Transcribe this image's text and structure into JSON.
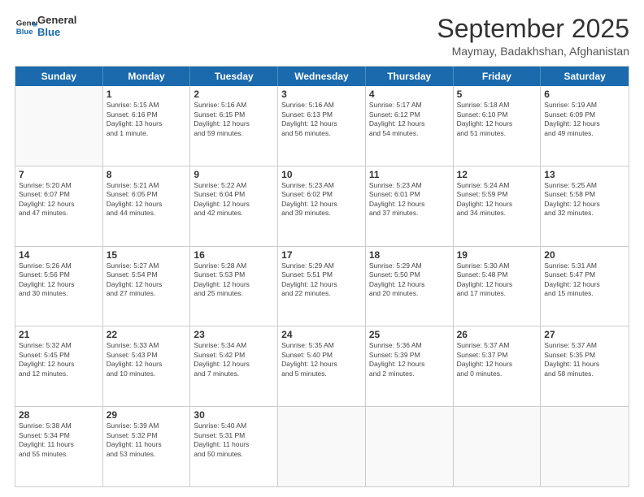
{
  "logo": {
    "line1": "General",
    "line2": "Blue"
  },
  "title": "September 2025",
  "location": "Maymay, Badakhshan, Afghanistan",
  "header_days": [
    "Sunday",
    "Monday",
    "Tuesday",
    "Wednesday",
    "Thursday",
    "Friday",
    "Saturday"
  ],
  "weeks": [
    [
      {
        "day": "",
        "lines": []
      },
      {
        "day": "1",
        "lines": [
          "Sunrise: 5:15 AM",
          "Sunset: 6:16 PM",
          "Daylight: 13 hours",
          "and 1 minute."
        ]
      },
      {
        "day": "2",
        "lines": [
          "Sunrise: 5:16 AM",
          "Sunset: 6:15 PM",
          "Daylight: 12 hours",
          "and 59 minutes."
        ]
      },
      {
        "day": "3",
        "lines": [
          "Sunrise: 5:16 AM",
          "Sunset: 6:13 PM",
          "Daylight: 12 hours",
          "and 56 minutes."
        ]
      },
      {
        "day": "4",
        "lines": [
          "Sunrise: 5:17 AM",
          "Sunset: 6:12 PM",
          "Daylight: 12 hours",
          "and 54 minutes."
        ]
      },
      {
        "day": "5",
        "lines": [
          "Sunrise: 5:18 AM",
          "Sunset: 6:10 PM",
          "Daylight: 12 hours",
          "and 51 minutes."
        ]
      },
      {
        "day": "6",
        "lines": [
          "Sunrise: 5:19 AM",
          "Sunset: 6:09 PM",
          "Daylight: 12 hours",
          "and 49 minutes."
        ]
      }
    ],
    [
      {
        "day": "7",
        "lines": [
          "Sunrise: 5:20 AM",
          "Sunset: 6:07 PM",
          "Daylight: 12 hours",
          "and 47 minutes."
        ]
      },
      {
        "day": "8",
        "lines": [
          "Sunrise: 5:21 AM",
          "Sunset: 6:05 PM",
          "Daylight: 12 hours",
          "and 44 minutes."
        ]
      },
      {
        "day": "9",
        "lines": [
          "Sunrise: 5:22 AM",
          "Sunset: 6:04 PM",
          "Daylight: 12 hours",
          "and 42 minutes."
        ]
      },
      {
        "day": "10",
        "lines": [
          "Sunrise: 5:23 AM",
          "Sunset: 6:02 PM",
          "Daylight: 12 hours",
          "and 39 minutes."
        ]
      },
      {
        "day": "11",
        "lines": [
          "Sunrise: 5:23 AM",
          "Sunset: 6:01 PM",
          "Daylight: 12 hours",
          "and 37 minutes."
        ]
      },
      {
        "day": "12",
        "lines": [
          "Sunrise: 5:24 AM",
          "Sunset: 5:59 PM",
          "Daylight: 12 hours",
          "and 34 minutes."
        ]
      },
      {
        "day": "13",
        "lines": [
          "Sunrise: 5:25 AM",
          "Sunset: 5:58 PM",
          "Daylight: 12 hours",
          "and 32 minutes."
        ]
      }
    ],
    [
      {
        "day": "14",
        "lines": [
          "Sunrise: 5:26 AM",
          "Sunset: 5:56 PM",
          "Daylight: 12 hours",
          "and 30 minutes."
        ]
      },
      {
        "day": "15",
        "lines": [
          "Sunrise: 5:27 AM",
          "Sunset: 5:54 PM",
          "Daylight: 12 hours",
          "and 27 minutes."
        ]
      },
      {
        "day": "16",
        "lines": [
          "Sunrise: 5:28 AM",
          "Sunset: 5:53 PM",
          "Daylight: 12 hours",
          "and 25 minutes."
        ]
      },
      {
        "day": "17",
        "lines": [
          "Sunrise: 5:29 AM",
          "Sunset: 5:51 PM",
          "Daylight: 12 hours",
          "and 22 minutes."
        ]
      },
      {
        "day": "18",
        "lines": [
          "Sunrise: 5:29 AM",
          "Sunset: 5:50 PM",
          "Daylight: 12 hours",
          "and 20 minutes."
        ]
      },
      {
        "day": "19",
        "lines": [
          "Sunrise: 5:30 AM",
          "Sunset: 5:48 PM",
          "Daylight: 12 hours",
          "and 17 minutes."
        ]
      },
      {
        "day": "20",
        "lines": [
          "Sunrise: 5:31 AM",
          "Sunset: 5:47 PM",
          "Daylight: 12 hours",
          "and 15 minutes."
        ]
      }
    ],
    [
      {
        "day": "21",
        "lines": [
          "Sunrise: 5:32 AM",
          "Sunset: 5:45 PM",
          "Daylight: 12 hours",
          "and 12 minutes."
        ]
      },
      {
        "day": "22",
        "lines": [
          "Sunrise: 5:33 AM",
          "Sunset: 5:43 PM",
          "Daylight: 12 hours",
          "and 10 minutes."
        ]
      },
      {
        "day": "23",
        "lines": [
          "Sunrise: 5:34 AM",
          "Sunset: 5:42 PM",
          "Daylight: 12 hours",
          "and 7 minutes."
        ]
      },
      {
        "day": "24",
        "lines": [
          "Sunrise: 5:35 AM",
          "Sunset: 5:40 PM",
          "Daylight: 12 hours",
          "and 5 minutes."
        ]
      },
      {
        "day": "25",
        "lines": [
          "Sunrise: 5:36 AM",
          "Sunset: 5:39 PM",
          "Daylight: 12 hours",
          "and 2 minutes."
        ]
      },
      {
        "day": "26",
        "lines": [
          "Sunrise: 5:37 AM",
          "Sunset: 5:37 PM",
          "Daylight: 12 hours",
          "and 0 minutes."
        ]
      },
      {
        "day": "27",
        "lines": [
          "Sunrise: 5:37 AM",
          "Sunset: 5:35 PM",
          "Daylight: 11 hours",
          "and 58 minutes."
        ]
      }
    ],
    [
      {
        "day": "28",
        "lines": [
          "Sunrise: 5:38 AM",
          "Sunset: 5:34 PM",
          "Daylight: 11 hours",
          "and 55 minutes."
        ]
      },
      {
        "day": "29",
        "lines": [
          "Sunrise: 5:39 AM",
          "Sunset: 5:32 PM",
          "Daylight: 11 hours",
          "and 53 minutes."
        ]
      },
      {
        "day": "30",
        "lines": [
          "Sunrise: 5:40 AM",
          "Sunset: 5:31 PM",
          "Daylight: 11 hours",
          "and 50 minutes."
        ]
      },
      {
        "day": "",
        "lines": []
      },
      {
        "day": "",
        "lines": []
      },
      {
        "day": "",
        "lines": []
      },
      {
        "day": "",
        "lines": []
      }
    ]
  ]
}
